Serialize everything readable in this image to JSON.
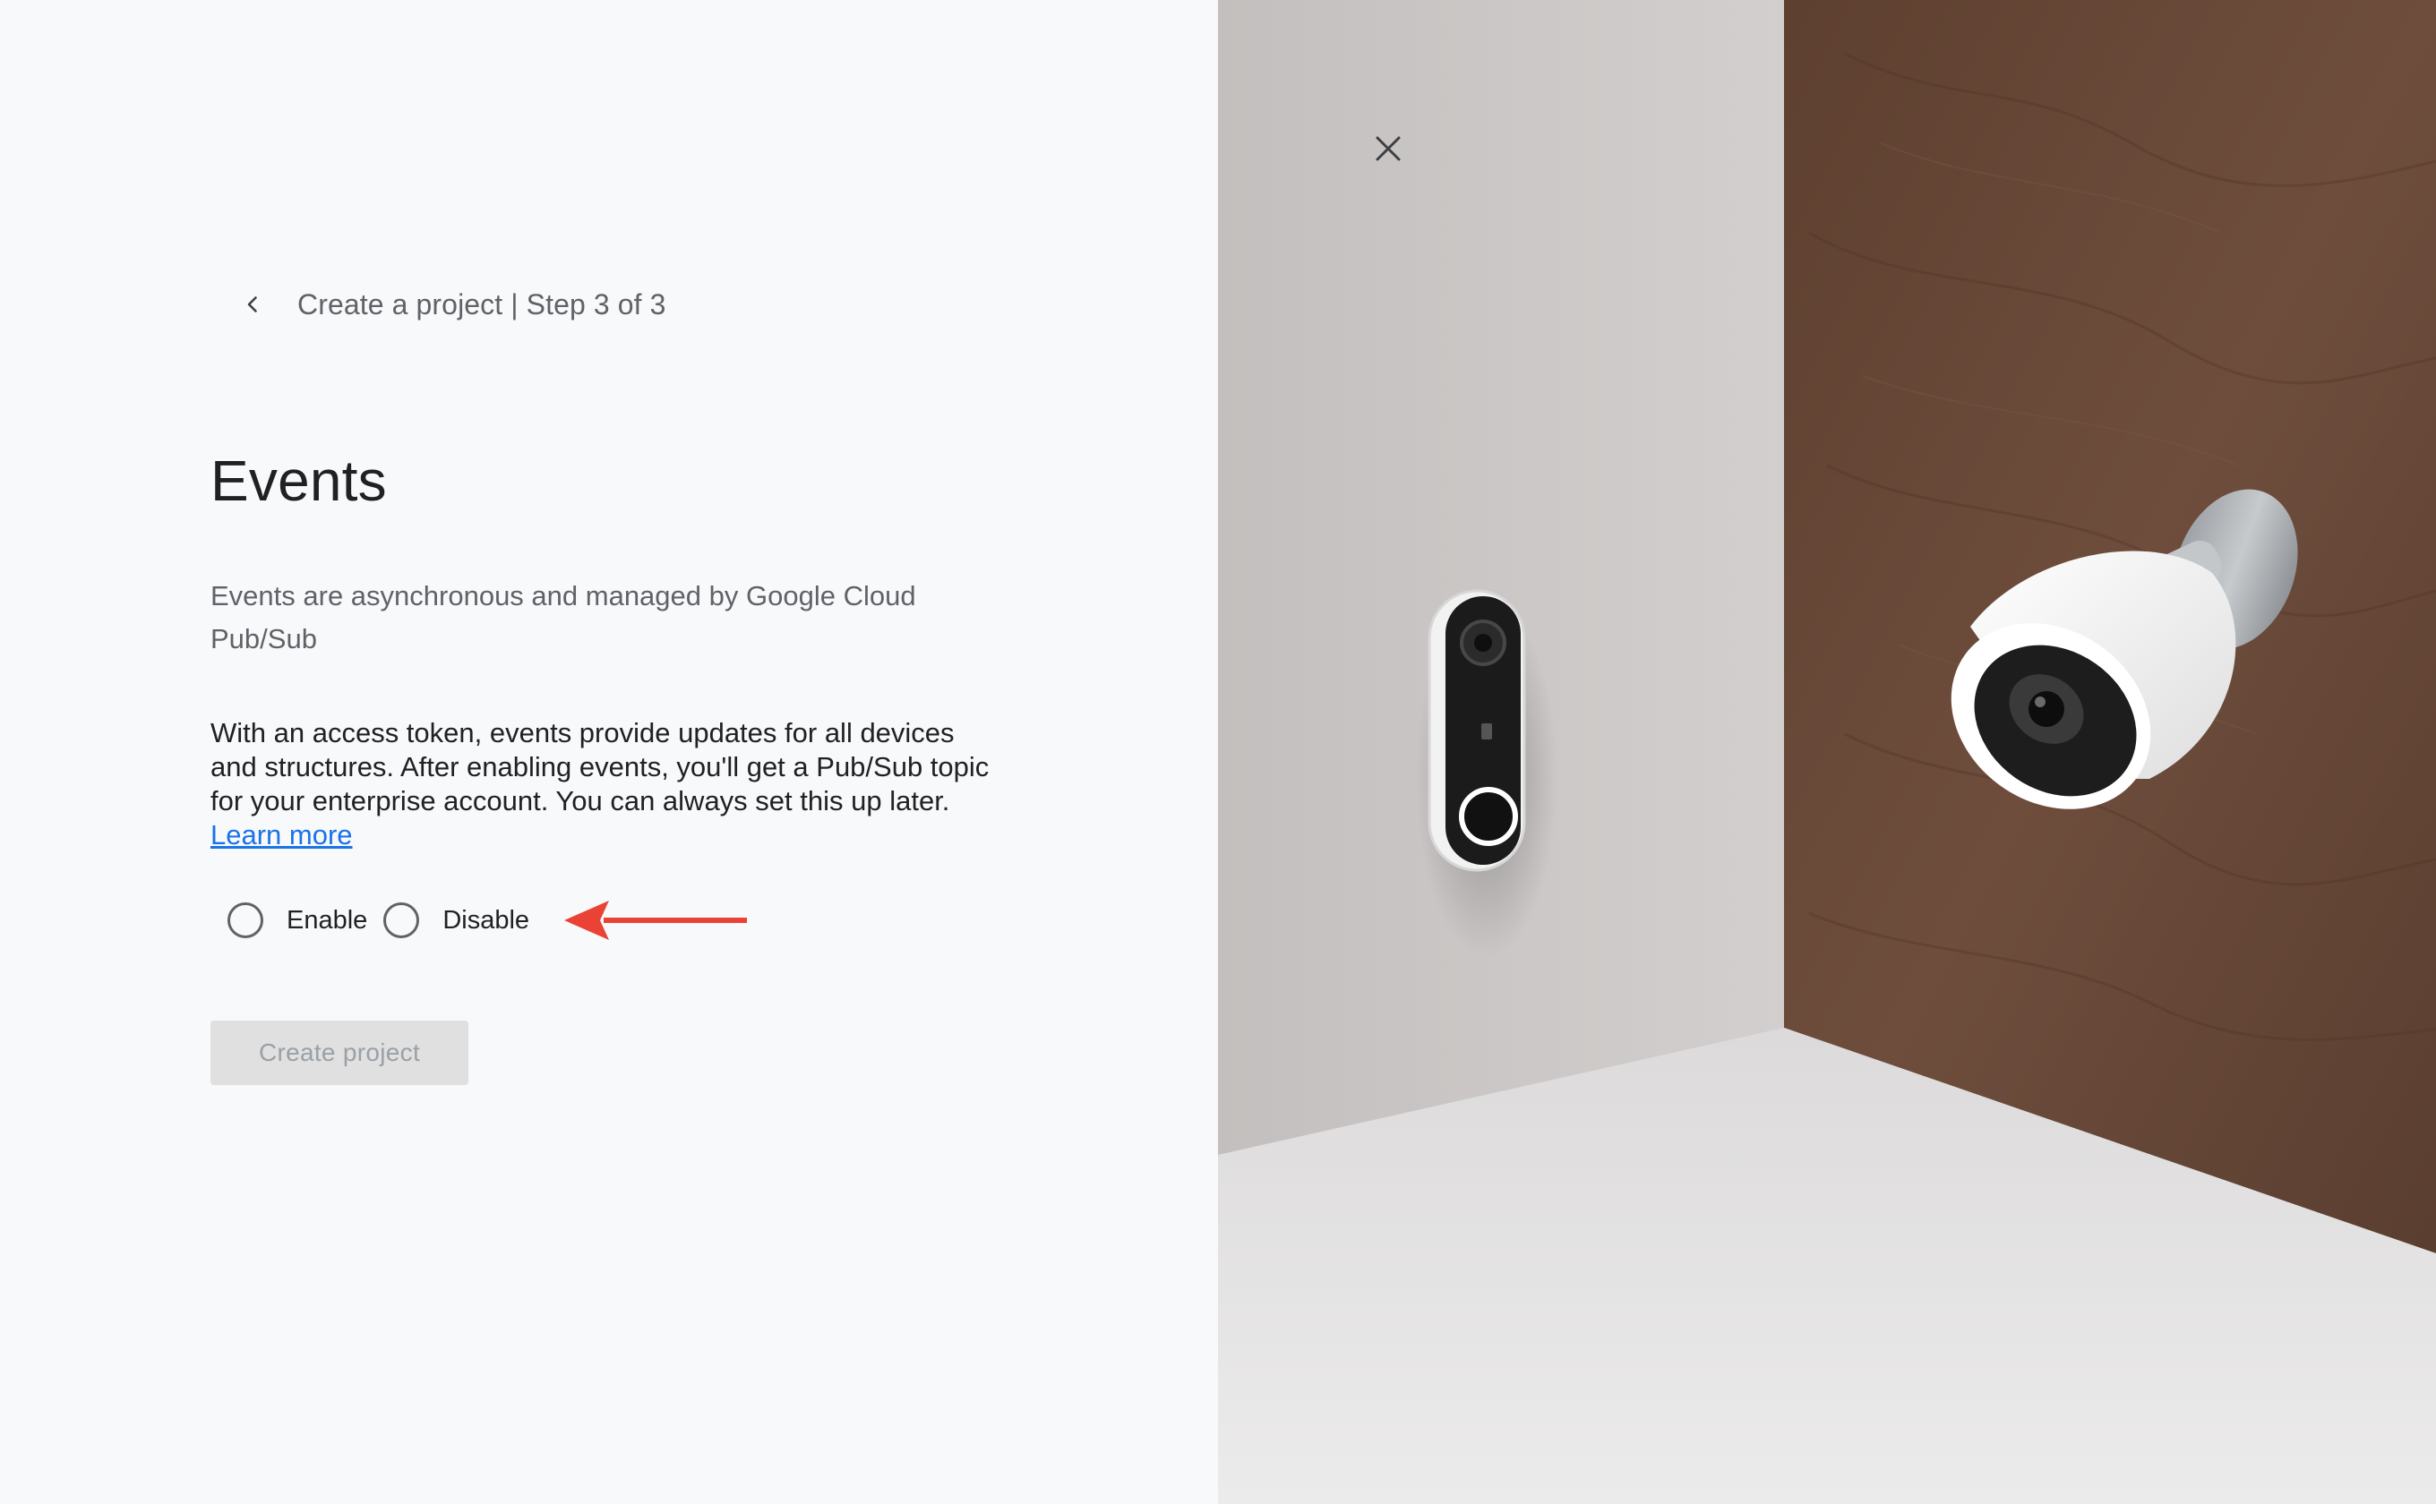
{
  "header": {
    "step_title": "Create a project | Step 3 of 3",
    "back_icon": "chevron-left-icon"
  },
  "main": {
    "title": "Events",
    "subtitle": "Events are asynchronous and managed by Google Cloud Pub/Sub",
    "description": "With an access token, events provide updates for all devices and structures. After enabling events, you'll get a Pub/Sub topic for your enterprise account. You can always set this up later.",
    "learn_more_label": "Learn more",
    "options": [
      {
        "label": "Enable",
        "selected": false
      },
      {
        "label": "Disable",
        "selected": false
      }
    ],
    "create_button_label": "Create project",
    "create_button_enabled": false
  },
  "annotation": {
    "arrow_color": "#ea4335",
    "arrow_icon": "arrow-left-icon"
  },
  "illustration": {
    "devices": [
      "doorbell",
      "outdoor-camera"
    ],
    "close_icon": "close-icon"
  },
  "colors": {
    "background": "#f8f9fa",
    "primary_text": "#202124",
    "secondary_text": "#5f6368",
    "link": "#1a73e8",
    "button_disabled_bg": "#e0e0e0",
    "button_disabled_text": "#9aa0a6",
    "wood": "#6b4a3a",
    "wall": "#c9c5c4"
  }
}
